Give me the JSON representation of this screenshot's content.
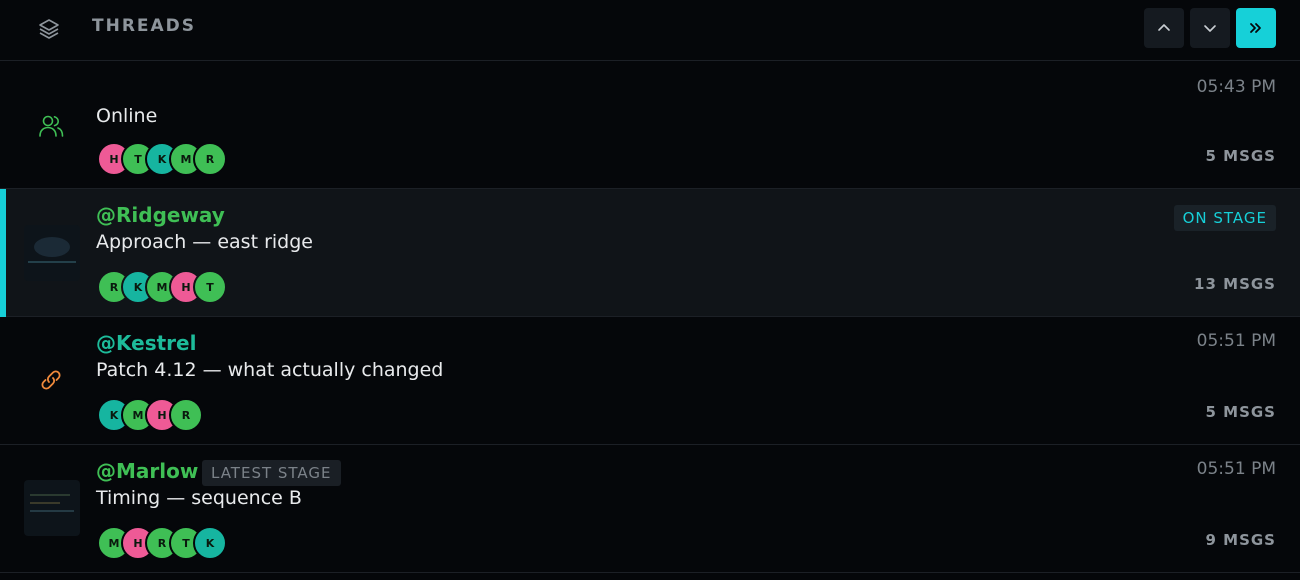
{
  "header": {
    "title": "THREADS",
    "buttons": {
      "up": "chevron-up-icon",
      "down": "chevron-down-icon",
      "expand": "double-chevron-right-icon"
    }
  },
  "colors": {
    "accent": "#16d0d8",
    "green": "#3fbf55",
    "teal": "#16b5a0",
    "pink": "#ee5a96"
  },
  "threads": [
    {
      "handle": "",
      "title": "Online",
      "time": "05:43 PM",
      "msgs": "5 MSGS",
      "icon": "users-icon",
      "avatars": [
        "H",
        "T",
        "K",
        "M",
        "R"
      ]
    },
    {
      "handle": "@Ridgeway",
      "title": "Approach — east ridge",
      "badge": "ON STAGE",
      "msgs": "13 MSGS",
      "avatars": [
        "R",
        "K",
        "M",
        "H",
        "T"
      ]
    },
    {
      "handle": "@Kestrel",
      "title": "Patch 4.12 — what actually changed",
      "time": "05:51 PM",
      "msgs": "5 MSGS",
      "icon": "link-icon",
      "avatars": [
        "K",
        "M",
        "H",
        "R"
      ]
    },
    {
      "handle": "@Marlow",
      "tag": "LATEST STAGE",
      "title": "Timing — sequence B",
      "time": "05:51 PM",
      "msgs": "9 MSGS",
      "avatars": [
        "M",
        "H",
        "R",
        "T",
        "K"
      ]
    }
  ]
}
